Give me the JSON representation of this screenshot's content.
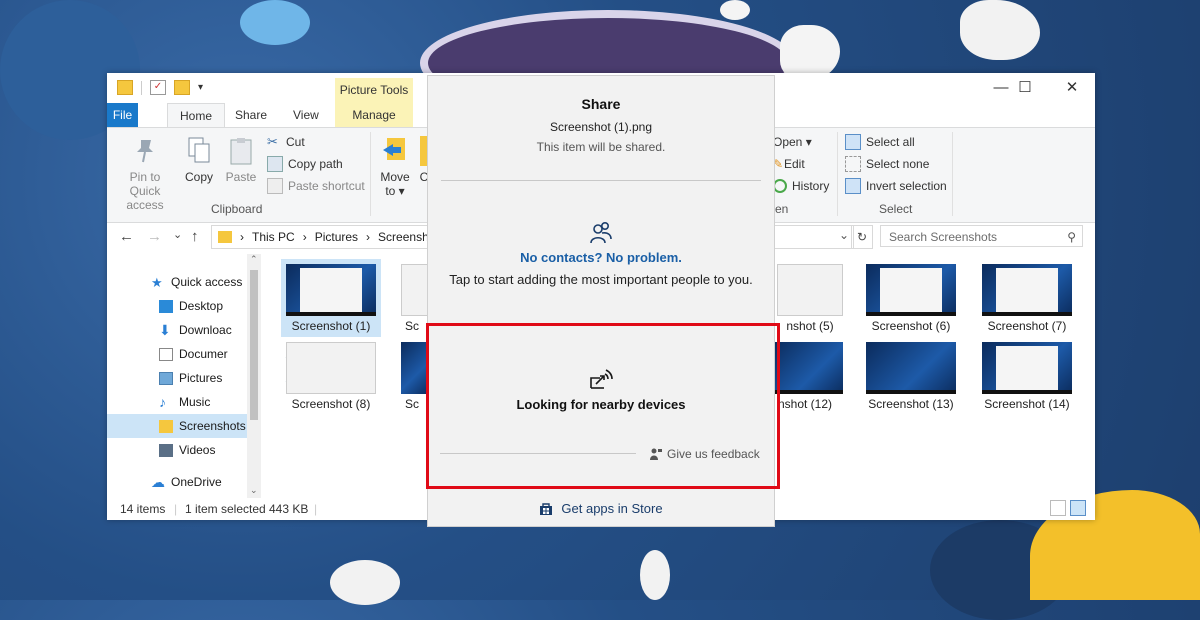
{
  "titlebar": {
    "contextual_group": "Picture Tools",
    "minimize": "—",
    "maximize": "☐",
    "close": "✕"
  },
  "tabs": {
    "file": "File",
    "home": "Home",
    "share": "Share",
    "view": "View",
    "manage": "Manage"
  },
  "ribbon": {
    "clipboard": {
      "pin": "Pin to Quick access",
      "copy": "Copy",
      "paste": "Paste",
      "cut": "Cut",
      "copy_path": "Copy path",
      "paste_shortcut": "Paste shortcut",
      "group_label": "Clipboard"
    },
    "organize": {
      "move_to": "Move to ▾",
      "copy_to_partial": "C"
    },
    "open": {
      "open": "Open ▾",
      "edit": "Edit",
      "history": "History",
      "group_label_partial": "en"
    },
    "select": {
      "select_all": "Select all",
      "select_none": "Select none",
      "invert": "Invert selection",
      "group_label": "Select"
    }
  },
  "address": {
    "back": "←",
    "forward": "→",
    "recent": "⌄",
    "up": "↑",
    "crumbs": [
      "This PC",
      "Pictures",
      "Screensh"
    ],
    "refresh": "↻",
    "search_placeholder": "Search Screenshots"
  },
  "nav": [
    {
      "label": "Quick access",
      "pinned": false
    },
    {
      "label": "Desktop",
      "pinned": true
    },
    {
      "label": "Downloac",
      "pinned": true
    },
    {
      "label": "Documer",
      "pinned": true
    },
    {
      "label": "Pictures",
      "pinned": true
    },
    {
      "label": "Music",
      "pinned": false
    },
    {
      "label": "Screenshots",
      "pinned": false,
      "selected": true
    },
    {
      "label": "Videos",
      "pinned": false
    },
    {
      "label": "OneDrive",
      "pinned": false
    }
  ],
  "files": [
    {
      "label": "Screenshot (1)",
      "selected": true
    },
    {
      "label": "Sc"
    },
    {
      "label": "nshot (5)"
    },
    {
      "label": "Screenshot (6)"
    },
    {
      "label": "Screenshot (7)"
    },
    {
      "label": "Screenshot (8)"
    },
    {
      "label": "Sc"
    },
    {
      "label": "nshot (12)"
    },
    {
      "label": "Screenshot (13)"
    },
    {
      "label": "Screenshot (14)"
    }
  ],
  "status": {
    "count": "14 items",
    "selected": "1 item selected",
    "size": "443 KB"
  },
  "share": {
    "title": "Share",
    "filename": "Screenshot (1).png",
    "note": "This item will be shared.",
    "no_contacts": "No contacts? No problem.",
    "tap_hint": "Tap to start adding the most important people to you.",
    "looking": "Looking for nearby devices",
    "feedback": "Give us feedback",
    "store": "Get apps in Store"
  },
  "colors": {
    "accent": "#1979ca",
    "highlight_box": "#e00a16",
    "link": "#1a5fa6",
    "picture_tools": "#fbf3b7"
  }
}
